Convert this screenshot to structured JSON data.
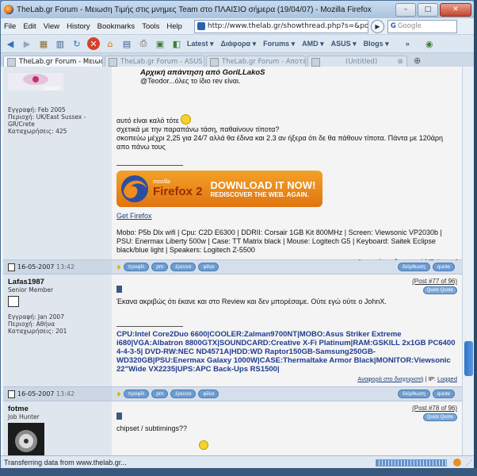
{
  "window": {
    "title": "TheLab.gr Forum - Μειωση Τιμής στις μνημες Team στο ΠΛΑΙΣΙΟ σήμερα (19/04/07) - Mozilla Firefox"
  },
  "menus": [
    "File",
    "Edit",
    "View",
    "History",
    "Bookmarks",
    "Tools",
    "Help"
  ],
  "url": "http://www.thelab.gr/showthread.php?s=&posti",
  "search": {
    "engine": "G",
    "placeholder": "Google"
  },
  "toolbar": {
    "items": [
      "Latest ▾",
      "Διάφορα ▾",
      "Forums ▾",
      "AMD ▾",
      "ASUS ▾",
      "Blogs ▾"
    ],
    "more": "»"
  },
  "tabs": [
    {
      "label": "TheLab.gr Forum - Μειωση...",
      "active": true
    },
    {
      "label": "TheLab.gr Forum - ASUS E...",
      "active": false
    },
    {
      "label": "TheLab.gr Forum - Αποτελέ...",
      "active": false
    },
    {
      "label": "(Untitled)",
      "active": false
    }
  ],
  "post1": {
    "user_info": [
      "Εγγραφή: Feb 2005",
      "Περιοχή: UK/East Sussex - GR/Crete",
      "Καταχωρήσεις: 425"
    ],
    "quote_title": "Αρχική απάντηση από GoriLLakoS",
    "quote_text": "@Teodor...όλες το ίδιο rev είναι.",
    "body": [
      "αυτό είναι καλό τότε",
      "σχετικά με την παραπάνω τάση, παθαίνουν τίποτα?",
      "σκοπεύω μέχρι 2,25 για 24/7 αλλά θα έδινα και 2.3 αν ήξερα ότι δε θα πάθουν τίποτα. Πάντα με 120άρη απο πάνω τους"
    ],
    "banner": {
      "brand": "mozilla",
      "product": "Firefox 2",
      "line1": "DOWNLOAD IT NOW!",
      "line2": "REDISCOVER THE WEB. AGAIN."
    },
    "get_firefox": "Get Firefox",
    "signature": "Mobo: P5b Dlx wifi | Cpu: C2D E6300 | DDRII: Corsair 1GB Kit 800MHz | Screen: Viewsonic VP2030b | PSU: Enermax Liberty 500w | Case: TT Matrix black | Mouse: Logitech G5 | Keyboard: Saitek Eclipse black/blue light | Speakers: Logitech Z-5500",
    "report": "Αναφορά στο διαχειριστή",
    "ip": "| IP:",
    "logged": "Logged"
  },
  "bar1": {
    "date": "16-05-2007",
    "time": "13:42",
    "buttons": [
      "προφίλ",
      "pm",
      "έρευνα",
      "φίλοι"
    ],
    "edit": "διόρθωση",
    "quote": "quote"
  },
  "post2": {
    "username": "Lafas1987",
    "title": "Senior Member",
    "user_info": [
      "Εγγραφή: Jan 2007",
      "Περιοχή: Αθήνα",
      "Καταχωρήσεις: 201"
    ],
    "postnum": "(Post #77 of 96)",
    "quickquote": "Quick Quote",
    "body": "Έκανα ακριβώς ότι έκανε και στο Review και δεν μπορέσαμε. Ούτε εγώ ούτε ο JohnX.",
    "signature": "CPU:Intel Core2Duo 6600|COOLER:Zalman9700NT|MOBO:Asus Striker Extreme i680|VGA:Albatron 8800GTX|SOUNDCARD:Creative X-Fi Platinum|RAM:GSKILL 2x1GB PC6400 4-4-3-5| DVD-RW:NEC ND4571A|HDD:WD Raptor150GB-Samsung250GB-WD320GB|PSU:Enermax Galaxy 1000W|CASE:Thermaltake Armor Black|MONITOR:Viewsonic 22\"Wide VX2235|UPS:APC Back-Ups RS1500|",
    "report": "Αναφορά στο διαχειριστή",
    "ip": "| IP:",
    "logged": "Logged"
  },
  "bar2": {
    "date": "16-05-2007",
    "time": "13:42",
    "buttons": [
      "προφίλ",
      "pm",
      "έρευνα",
      "φίλοι"
    ],
    "edit": "διόρθωση",
    "quote": "quote"
  },
  "post3": {
    "username": "fotme",
    "title": "Job Hunter",
    "postnum": "(Post #78 of 96)",
    "quickquote": "Quick Quote",
    "body": "chipset / subtimings??"
  },
  "status": {
    "text": "Transferring data from www.thelab.gr..."
  }
}
